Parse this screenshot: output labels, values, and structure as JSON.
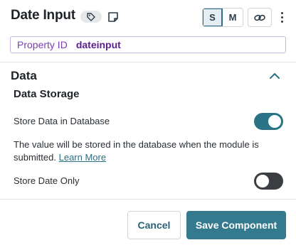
{
  "header": {
    "title": "Date Input",
    "tag_icon": "tag-icon",
    "note_icon": "note-icon",
    "size_options": [
      "S",
      "M"
    ],
    "selected_size": "S",
    "link_icon": "link-icon",
    "more_icon": "more-vertical-icon",
    "property": {
      "label": "Property ID",
      "value": "dateinput"
    }
  },
  "section": {
    "title": "Data",
    "chevron_icon": "chevron-up-icon",
    "subsection_title": "Data Storage",
    "settings": [
      {
        "label": "Store Data in Database",
        "enabled": true
      },
      {
        "label": "Store Date Only",
        "enabled": false
      }
    ],
    "description": "The value will be stored in the database when the module is submitted.",
    "learn_more": "Learn More"
  },
  "footer": {
    "cancel_label": "Cancel",
    "save_label": "Save Component"
  },
  "colors": {
    "accent": "#347a8e",
    "toggle_on": "#2a7386",
    "toggle_off": "#3a3d42",
    "property_text": "#7b3fb0"
  }
}
